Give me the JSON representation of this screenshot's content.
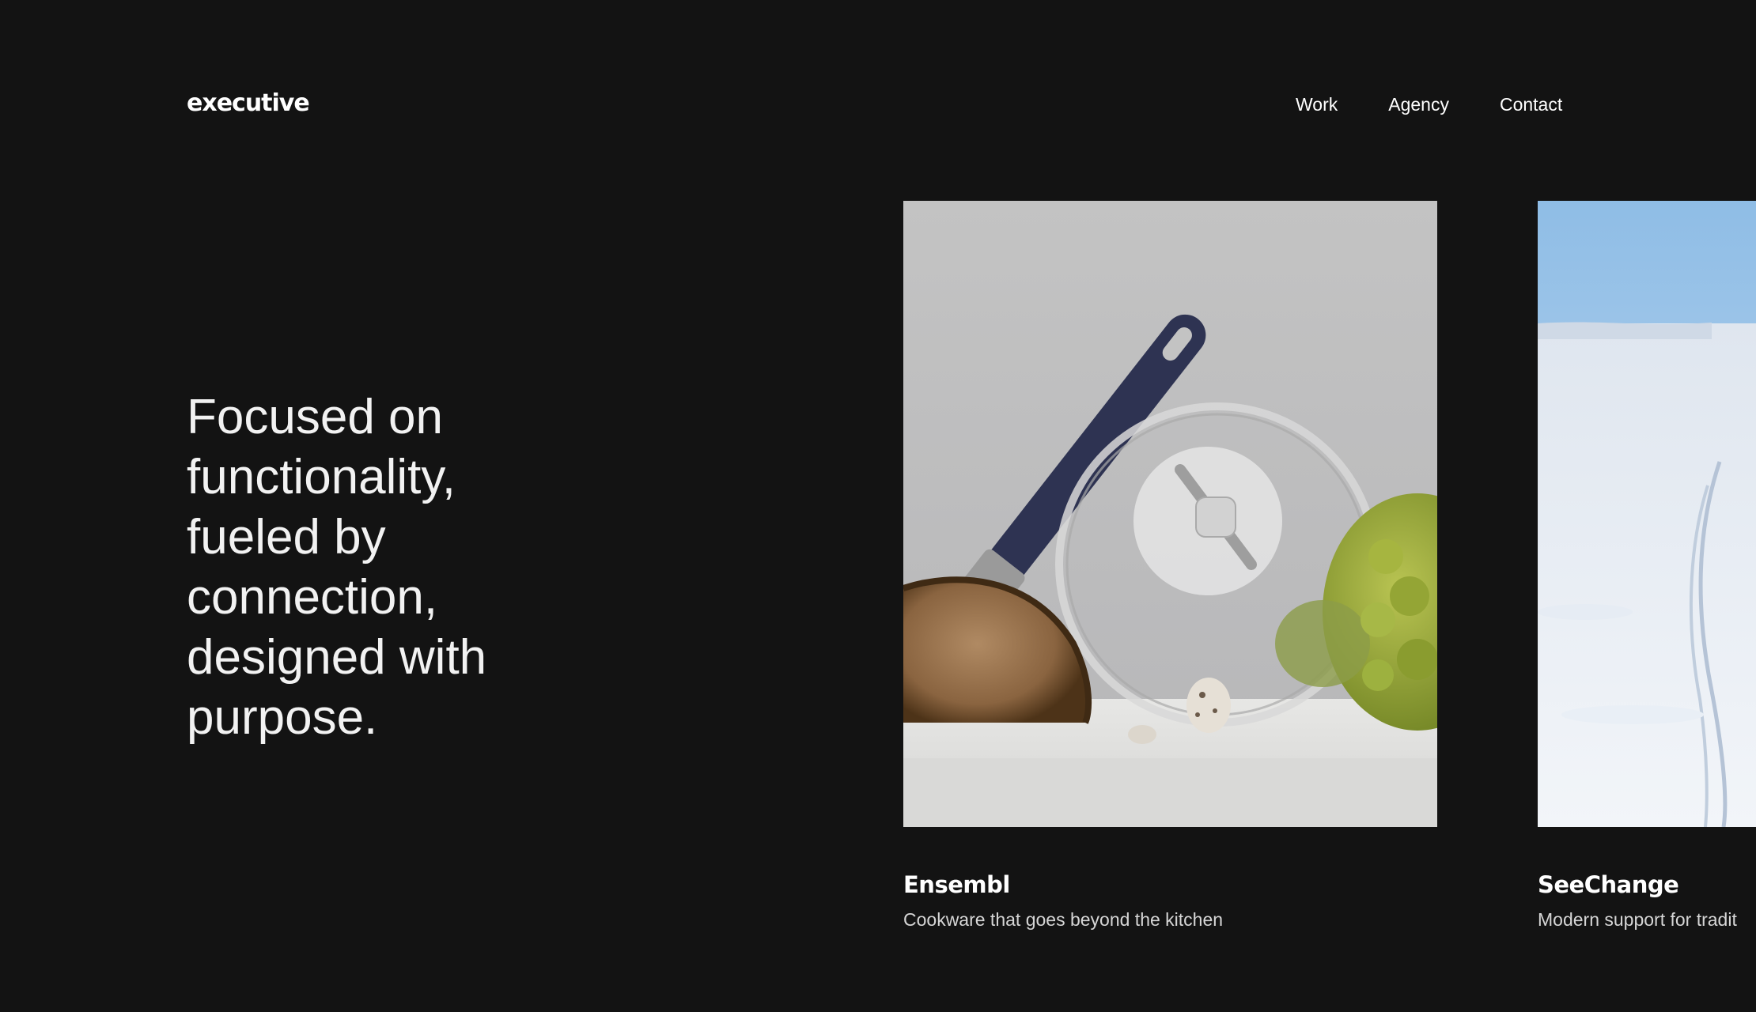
{
  "header": {
    "logo": "executive",
    "nav": {
      "work": "Work",
      "agency": "Agency",
      "contact": "Contact"
    }
  },
  "hero": {
    "tagline": "Focused on functionality, fueled by connection, designed with purpose."
  },
  "projects": [
    {
      "title": "Ensembl",
      "subtitle": "Cookware that goes beyond the kitchen",
      "image": "cookware-still-life-image"
    },
    {
      "title": "SeeChange",
      "subtitle": "Modern support for tradit",
      "image": "snowy-landscape-image"
    }
  ],
  "colors": {
    "background": "#131313",
    "text": "#ffffff",
    "muted_text": "#d6d6d6",
    "pan_handle": "#2e3352"
  }
}
